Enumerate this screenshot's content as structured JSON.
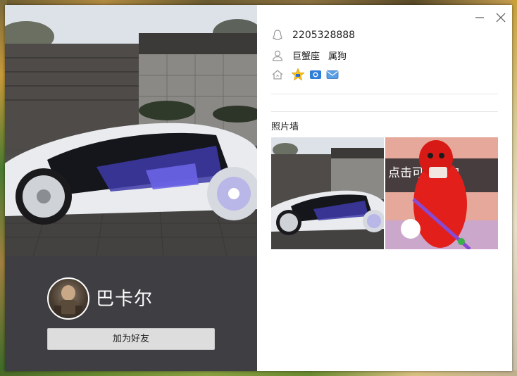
{
  "profile": {
    "nickname": "巴卡尔",
    "qq_number": "2205328888",
    "zodiac": "巨蟹座",
    "chinese_zodiac": "属狗",
    "add_friend_label": "加为好友"
  },
  "photo_wall": {
    "title": "照片墙",
    "photos": [
      {
        "name": "futuristic-white-concept-car"
      },
      {
        "name": "red-monster-character-game-screenshot",
        "overlay_text": "点击可以开启"
      }
    ]
  },
  "icons": {
    "qq": "qq-penguin-icon",
    "person": "person-icon",
    "home": "home-icon",
    "star_badge": "star-badge-icon",
    "photo_badge": "photo-badge-icon",
    "mail_badge": "mail-badge-icon"
  },
  "colors": {
    "left_panel_bg": "#3f3e42",
    "button_bg": "#dddddd",
    "text": "#222222"
  }
}
